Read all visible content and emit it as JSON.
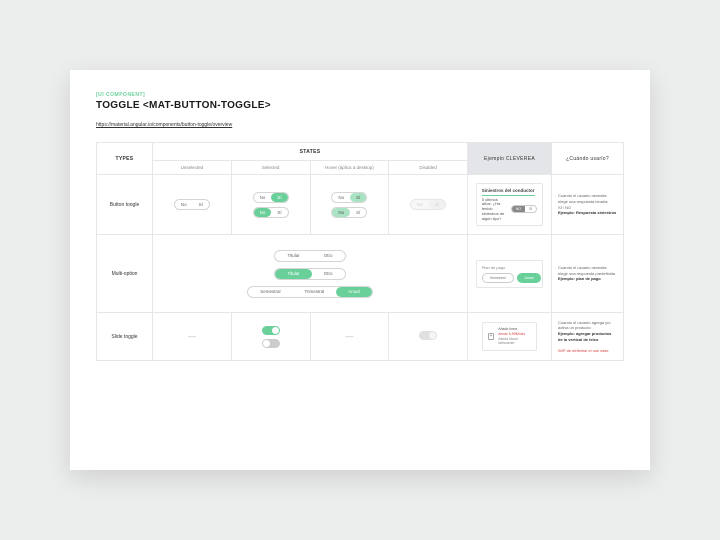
{
  "eyebrow": "[UI COMPONENT]",
  "title": "TOGGLE <MAT-BUTTON-TOGGLE>",
  "link": "https://material.angular.io/components/button-toggle/overview",
  "headers": {
    "types": "TYPES",
    "states": "STATES",
    "example": "Ejemplo CLEVEREA",
    "when": "¿Cuándo usarlo?"
  },
  "subheaders": {
    "unselected": "Unselected",
    "selected": "Selected",
    "hover": "Hover (aplica a desktop)",
    "disabled": "Disabled"
  },
  "rows": {
    "button": {
      "label": "Button toogle",
      "opts": {
        "no": "No",
        "si": "Sí"
      },
      "example": {
        "hdr": "Siniestros del conductor",
        "q": "5 últimos años: ¿Ha tenido siniestros de algún tipo?",
        "no": "NO",
        "si": "SÍ"
      },
      "desc_l1": "Cuando el usuario necesita elegir una respuesta binaria:",
      "desc_l2": "SÍ / NO",
      "desc_l3": "Ejemplo: Respuesta siniestros"
    },
    "multi": {
      "label": "Multi-option",
      "titular": "Titular",
      "otro": "Otro",
      "semestral": "Semestral",
      "trimestral": "Trimestral",
      "anual": "Anual",
      "example": {
        "hdr": "Plan de pago",
        "a": "Semestral",
        "b": "Anual"
      },
      "desc_l1": "Cuando el usuario necesita elegir una respuesta predefinida",
      "desc_l2": "Ejemplo: plan de pago"
    },
    "slide": {
      "label": "Slide toggle",
      "example": {
        "l1": "Añadir línea",
        "l2": "desde 5,99€/mes",
        "l3": "Afecta litoral latinoamer"
      },
      "desc_l1": "Cuando el usuario agrega y/o activa un producto",
      "desc_l2": "Ejemplo: agregar productos de la vertical de telco",
      "desc_red": "WIP de definirse el use case"
    }
  }
}
